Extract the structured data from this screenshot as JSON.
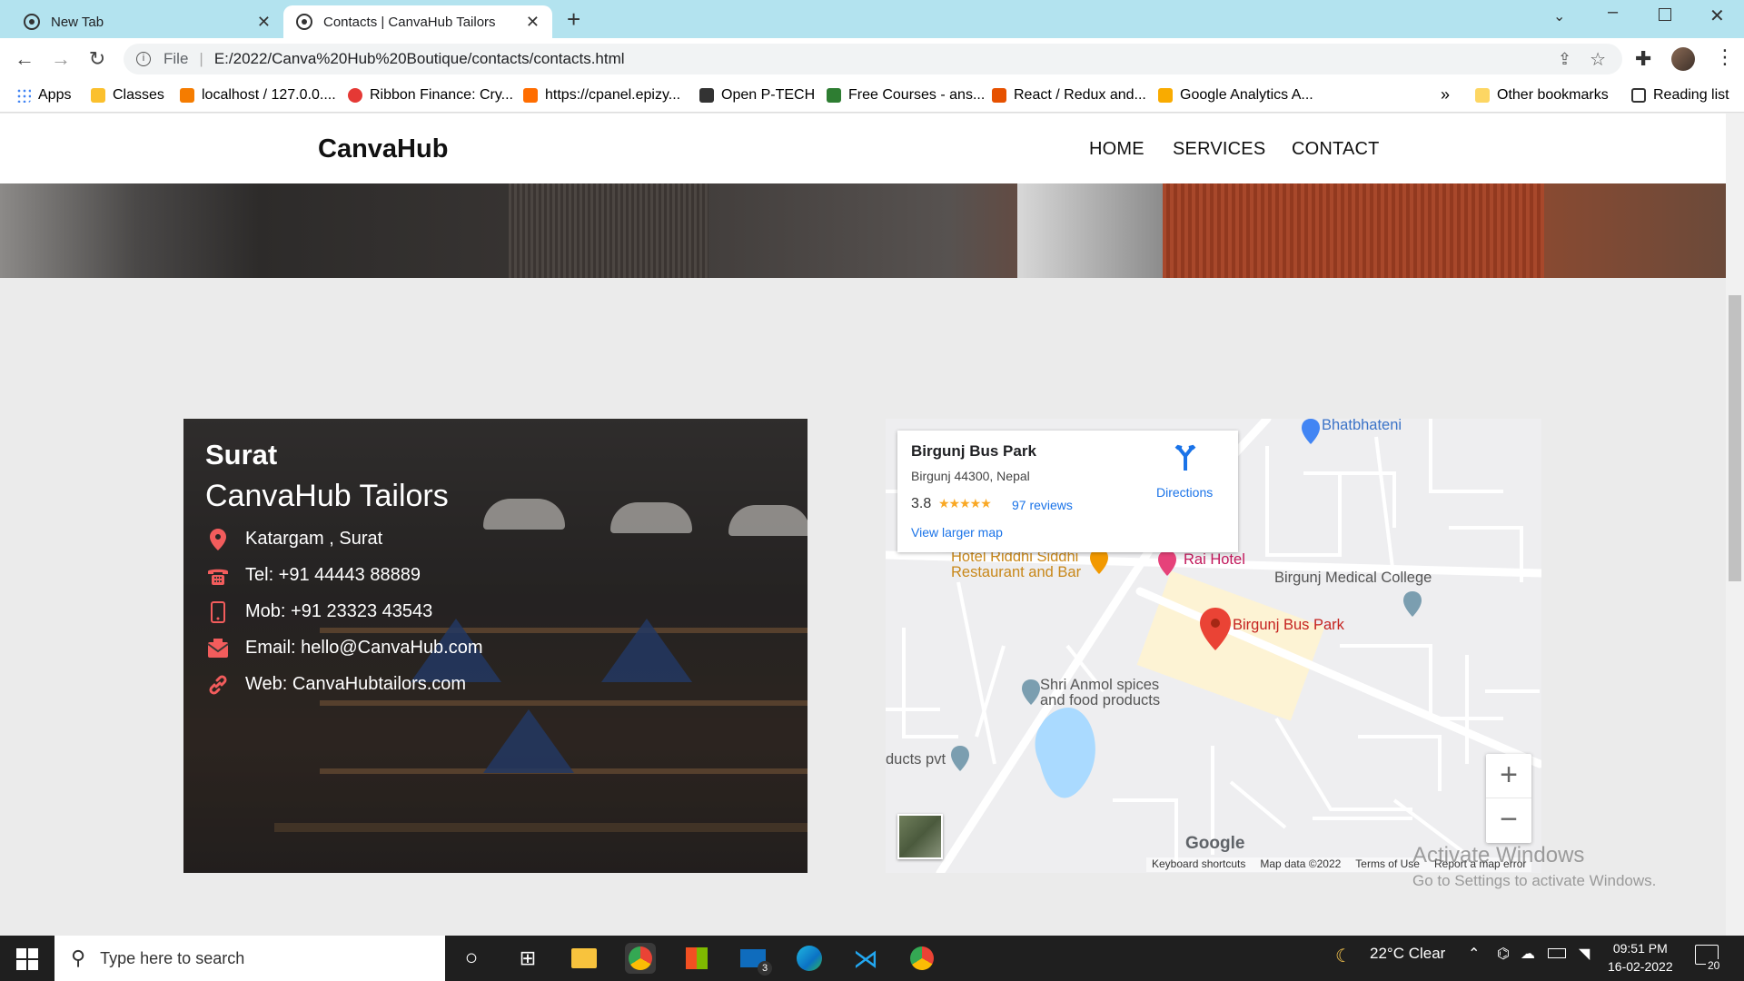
{
  "browser": {
    "tabs": [
      {
        "title": "New Tab"
      },
      {
        "title": "Contacts | CanvaHub Tailors"
      }
    ],
    "url_scheme_label": "File",
    "url": "E:/2022/Canva%20Hub%20Boutique/contacts/contacts.html",
    "bookmarks": [
      {
        "label": "Apps",
        "color": "#4285f4"
      },
      {
        "label": "Classes",
        "color": "#fbc02d"
      },
      {
        "label": "localhost / 127.0.0....",
        "color": "#f57c00"
      },
      {
        "label": "Ribbon Finance: Cry...",
        "color": "#e53935"
      },
      {
        "label": "https://cpanel.epizy...",
        "color": "#ff6d00"
      },
      {
        "label": "Open P-TECH",
        "color": "#333333"
      },
      {
        "label": "Free Courses - ans...",
        "color": "#2e7d32"
      },
      {
        "label": "React / Redux and...",
        "color": "#e65100"
      },
      {
        "label": "Google Analytics A...",
        "color": "#f9ab00"
      }
    ],
    "overflow_label": "»",
    "other_bookmarks": "Other bookmarks",
    "reading_list": "Reading list"
  },
  "site": {
    "brand": "CanvaHub",
    "nav": [
      "HOME",
      "SERVICES",
      "CONTACT"
    ]
  },
  "contact": {
    "city": "Surat",
    "business": "CanvaHub Tailors",
    "rows": [
      {
        "icon": "location-pin-icon",
        "text": "Katargam , Surat"
      },
      {
        "icon": "telephone-icon",
        "text": "Tel: +91 44443 88889"
      },
      {
        "icon": "mobile-phone-icon",
        "text": "Mob: +91 23323 43543"
      },
      {
        "icon": "email-icon",
        "text": "Email: hello@CanvaHub.com"
      },
      {
        "icon": "link-icon",
        "text": "Web: CanvaHubtailors.com"
      }
    ],
    "accent_color": "#f25c5c"
  },
  "map": {
    "place_name": "Birgunj Bus Park",
    "place_address": "Birgunj 44300, Nepal",
    "rating": "3.8",
    "stars": "★★★★★",
    "reviews": "97 reviews",
    "directions": "Directions",
    "view_larger": "View larger map",
    "labels": {
      "bhatbhateni": "Bhatbhateni",
      "hotel": "Hotel Riddhi Siddhi",
      "restaurant": "Restaurant and Bar",
      "rai_hotel": "Rai Hotel",
      "medical": "Birgunj Medical College",
      "bus_park": "Birgunj Bus Park",
      "spices1": "Shri Anmol spices",
      "spices2": "and food products",
      "products": "ducts pvt"
    },
    "zoom_in": "+",
    "zoom_out": "−",
    "google": "Google",
    "footer": [
      "Keyboard shortcuts",
      "Map data ©2022",
      "Terms of Use",
      "Report a map error"
    ]
  },
  "watermark": {
    "line1": "Activate Windows",
    "line2": "Go to Settings to activate Windows."
  },
  "taskbar": {
    "search_placeholder": "Type here to search",
    "weather": "22°C  Clear",
    "time": "09:51 PM",
    "date": "16-02-2022",
    "mail_badge": "3",
    "notifications": "20"
  }
}
